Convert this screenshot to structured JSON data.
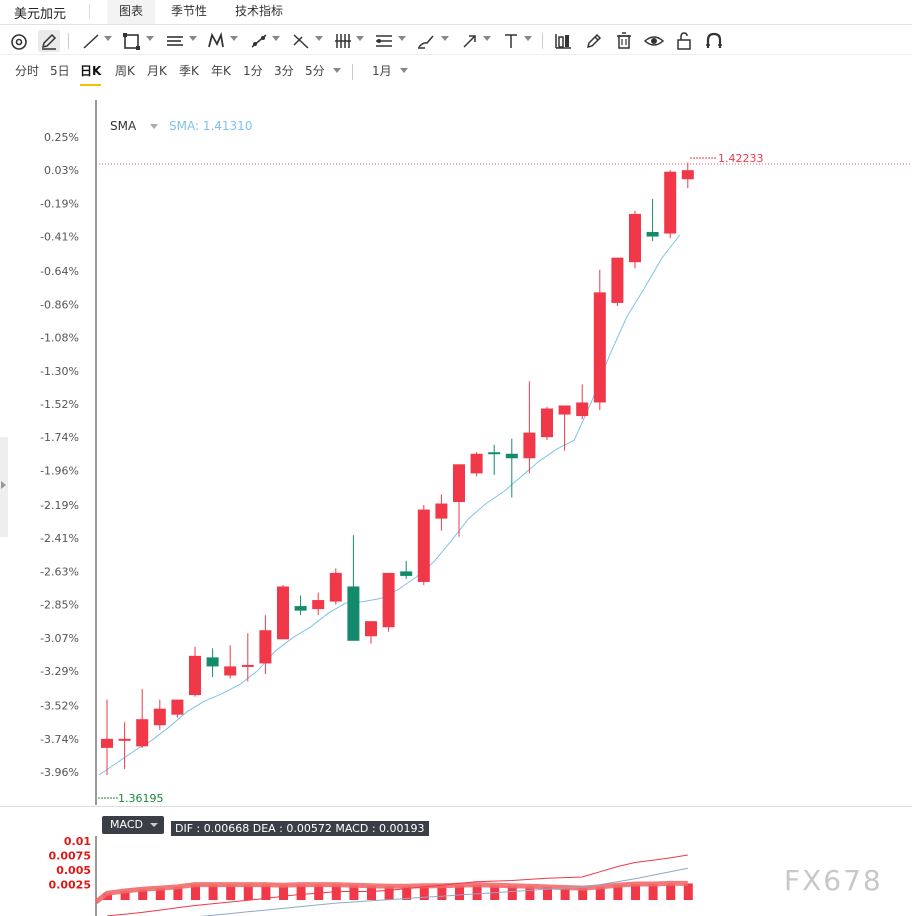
{
  "header": {
    "title": "美元加元",
    "tabs": [
      {
        "label": "图表",
        "active": true
      },
      {
        "label": "季节性",
        "active": false
      },
      {
        "label": "技术指标",
        "active": false
      }
    ]
  },
  "toolbar": {
    "icons": [
      "crosshair-icon",
      "pencil-icon",
      "trend-line-icon",
      "rectangle-icon",
      "horizontal-lines-icon",
      "pattern-icon",
      "multi-point-icon",
      "fibonacci-icon",
      "vertical-bars-icon",
      "channel-icon",
      "brush-icon",
      "arrow-icon",
      "text-icon",
      "candle-icon",
      "edit-icon",
      "trash-icon",
      "eye-icon",
      "lock-icon",
      "magnet-icon"
    ]
  },
  "periods": {
    "items": [
      "分时",
      "5日",
      "日K",
      "周K",
      "月K",
      "季K",
      "年K",
      "1分",
      "3分",
      "5分"
    ],
    "active": "日K",
    "range": "1月"
  },
  "indicator": {
    "name": "SMA",
    "value_label": "SMA: 1.41310",
    "color": "#7ec3ea"
  },
  "price_markers": {
    "high": "1.42233",
    "low": "1.36195"
  },
  "macd": {
    "name": "MACD",
    "values_label": "DIF : 0.00668   DEA : 0.00572   MACD : 0.00193"
  },
  "watermark": "FX678",
  "colors": {
    "up": "#f03848",
    "down": "#138a6c",
    "sma": "#7ec3ea"
  },
  "chart_data": {
    "type": "candlestick",
    "y_axis_labels": [
      "0.25%",
      "0.03%",
      "-0.19%",
      "-0.41%",
      "-0.64%",
      "-0.86%",
      "-1.08%",
      "-1.30%",
      "-1.52%",
      "-1.74%",
      "-1.96%",
      "-2.19%",
      "-2.41%",
      "-2.63%",
      "-2.85%",
      "-3.07%",
      "-3.29%",
      "-3.52%",
      "-3.74%",
      "-3.96%"
    ],
    "y_axis_values": [
      0.25,
      0.03,
      -0.19,
      -0.41,
      -0.64,
      -0.86,
      -1.08,
      -1.3,
      -1.52,
      -1.74,
      -1.96,
      -2.19,
      -2.41,
      -2.63,
      -2.85,
      -3.07,
      -3.29,
      -3.52,
      -3.74,
      -3.96
    ],
    "y_axis_unit": "percent",
    "candles_pct": [
      {
        "o": -3.8,
        "h": -3.48,
        "l": -3.98,
        "c": -3.74
      },
      {
        "o": -3.74,
        "h": -3.63,
        "l": -3.94,
        "c": -3.74
      },
      {
        "o": -3.79,
        "h": -3.41,
        "l": -3.8,
        "c": -3.61
      },
      {
        "o": -3.65,
        "h": -3.48,
        "l": -3.68,
        "c": -3.54
      },
      {
        "o": -3.58,
        "h": -3.48,
        "l": -3.6,
        "c": -3.48
      },
      {
        "o": -3.45,
        "h": -3.13,
        "l": -3.46,
        "c": -3.19
      },
      {
        "o": -3.2,
        "h": -3.14,
        "l": -3.33,
        "c": -3.26
      },
      {
        "o": -3.32,
        "h": -3.12,
        "l": -3.34,
        "c": -3.26
      },
      {
        "o": -3.26,
        "h": -3.04,
        "l": -3.36,
        "c": -3.25
      },
      {
        "o": -3.24,
        "h": -2.92,
        "l": -3.31,
        "c": -3.02
      },
      {
        "o": -3.08,
        "h": -2.72,
        "l": -3.08,
        "c": -2.73
      },
      {
        "o": -2.86,
        "h": -2.79,
        "l": -2.92,
        "c": -2.89
      },
      {
        "o": -2.88,
        "h": -2.77,
        "l": -2.92,
        "c": -2.82
      },
      {
        "o": -2.83,
        "h": -2.61,
        "l": -2.85,
        "c": -2.64
      },
      {
        "o": -2.73,
        "h": -2.39,
        "l": -3.02,
        "c": -3.09
      },
      {
        "o": -3.06,
        "h": -2.97,
        "l": -3.11,
        "c": -2.96
      },
      {
        "o": -3.0,
        "h": -2.65,
        "l": -3.03,
        "c": -2.64
      },
      {
        "o": -2.63,
        "h": -2.56,
        "l": -2.68,
        "c": -2.66
      },
      {
        "o": -2.7,
        "h": -2.19,
        "l": -2.72,
        "c": -2.22
      },
      {
        "o": -2.28,
        "h": -2.12,
        "l": -2.36,
        "c": -2.18
      },
      {
        "o": -2.17,
        "h": -1.93,
        "l": -2.4,
        "c": -1.92
      },
      {
        "o": -1.98,
        "h": -1.84,
        "l": -2.0,
        "c": -1.85
      },
      {
        "o": -1.84,
        "h": -1.79,
        "l": -1.99,
        "c": -1.85
      },
      {
        "o": -1.85,
        "h": -1.75,
        "l": -2.14,
        "c": -1.88
      },
      {
        "o": -1.88,
        "h": -1.37,
        "l": -1.98,
        "c": -1.71
      },
      {
        "o": -1.74,
        "h": -1.54,
        "l": -1.76,
        "c": -1.55
      },
      {
        "o": -1.59,
        "h": -1.53,
        "l": -1.83,
        "c": -1.53
      },
      {
        "o": -1.6,
        "h": -1.39,
        "l": -1.62,
        "c": -1.51
      },
      {
        "o": -1.51,
        "h": -0.63,
        "l": -1.56,
        "c": -0.78
      },
      {
        "o": -0.85,
        "h": -0.55,
        "l": -0.87,
        "c": -0.55
      },
      {
        "o": -0.58,
        "h": -0.24,
        "l": -0.62,
        "c": -0.26
      },
      {
        "o": -0.38,
        "h": -0.16,
        "l": -0.44,
        "c": -0.41
      },
      {
        "o": -0.39,
        "h": 0.03,
        "l": -0.42,
        "c": 0.02
      },
      {
        "o": -0.03,
        "h": 0.08,
        "l": -0.09,
        "c": 0.03
      }
    ],
    "sma_pct": [
      -3.98,
      -3.9,
      -3.82,
      -3.75,
      -3.66,
      -3.56,
      -3.49,
      -3.44,
      -3.38,
      -3.29,
      -3.16,
      -3.07,
      -3.0,
      -2.91,
      -2.84,
      -2.83,
      -2.81,
      -2.75,
      -2.67,
      -2.57,
      -2.43,
      -2.28,
      -2.18,
      -2.1,
      -2.0,
      -1.9,
      -1.82,
      -1.76,
      -1.5,
      -1.2,
      -0.94,
      -0.75,
      -0.55,
      -0.4
    ],
    "macd_axis_labels": [
      "0.01",
      "0.0075",
      "0.005",
      "0.0025"
    ],
    "macd_hist": [
      0.0009,
      0.0013,
      0.0016,
      0.0018,
      0.002,
      0.0024,
      0.0024,
      0.0024,
      0.0024,
      0.0024,
      0.0023,
      0.0024,
      0.0024,
      0.0024,
      0.0023,
      0.0022,
      0.0021,
      0.0021,
      0.0022,
      0.0022,
      0.0023,
      0.0024,
      0.0023,
      0.0022,
      0.0021,
      0.002,
      0.0019,
      0.0018,
      0.002,
      0.0023,
      0.0025,
      0.0025,
      0.0026,
      0.0026
    ],
    "macd_dif": [
      -0.003,
      -0.0027,
      -0.0024,
      -0.002,
      -0.0016,
      -0.0012,
      -0.0009,
      -0.0006,
      -0.0003,
      0.0,
      0.0004,
      0.0007,
      0.0009,
      0.0012,
      0.0012,
      0.0012,
      0.0014,
      0.0017,
      0.002,
      0.0023,
      0.0026,
      0.0029,
      0.003,
      0.0031,
      0.0033,
      0.0035,
      0.0036,
      0.0037,
      0.0046,
      0.0055,
      0.0062,
      0.0066,
      0.007,
      0.0075
    ],
    "macd_dea": [
      -0.005,
      -0.0046,
      -0.0042,
      -0.0039,
      -0.0035,
      -0.0032,
      -0.0029,
      -0.0026,
      -0.0023,
      -0.002,
      -0.0017,
      -0.0014,
      -0.0011,
      -0.0008,
      -0.0006,
      -0.0004,
      -0.0002,
      0.0,
      0.0002,
      0.0004,
      0.0006,
      0.0008,
      0.001,
      0.0012,
      0.0014,
      0.0016,
      0.0018,
      0.002,
      0.0024,
      0.0029,
      0.0034,
      0.004,
      0.0046,
      0.0052
    ]
  }
}
